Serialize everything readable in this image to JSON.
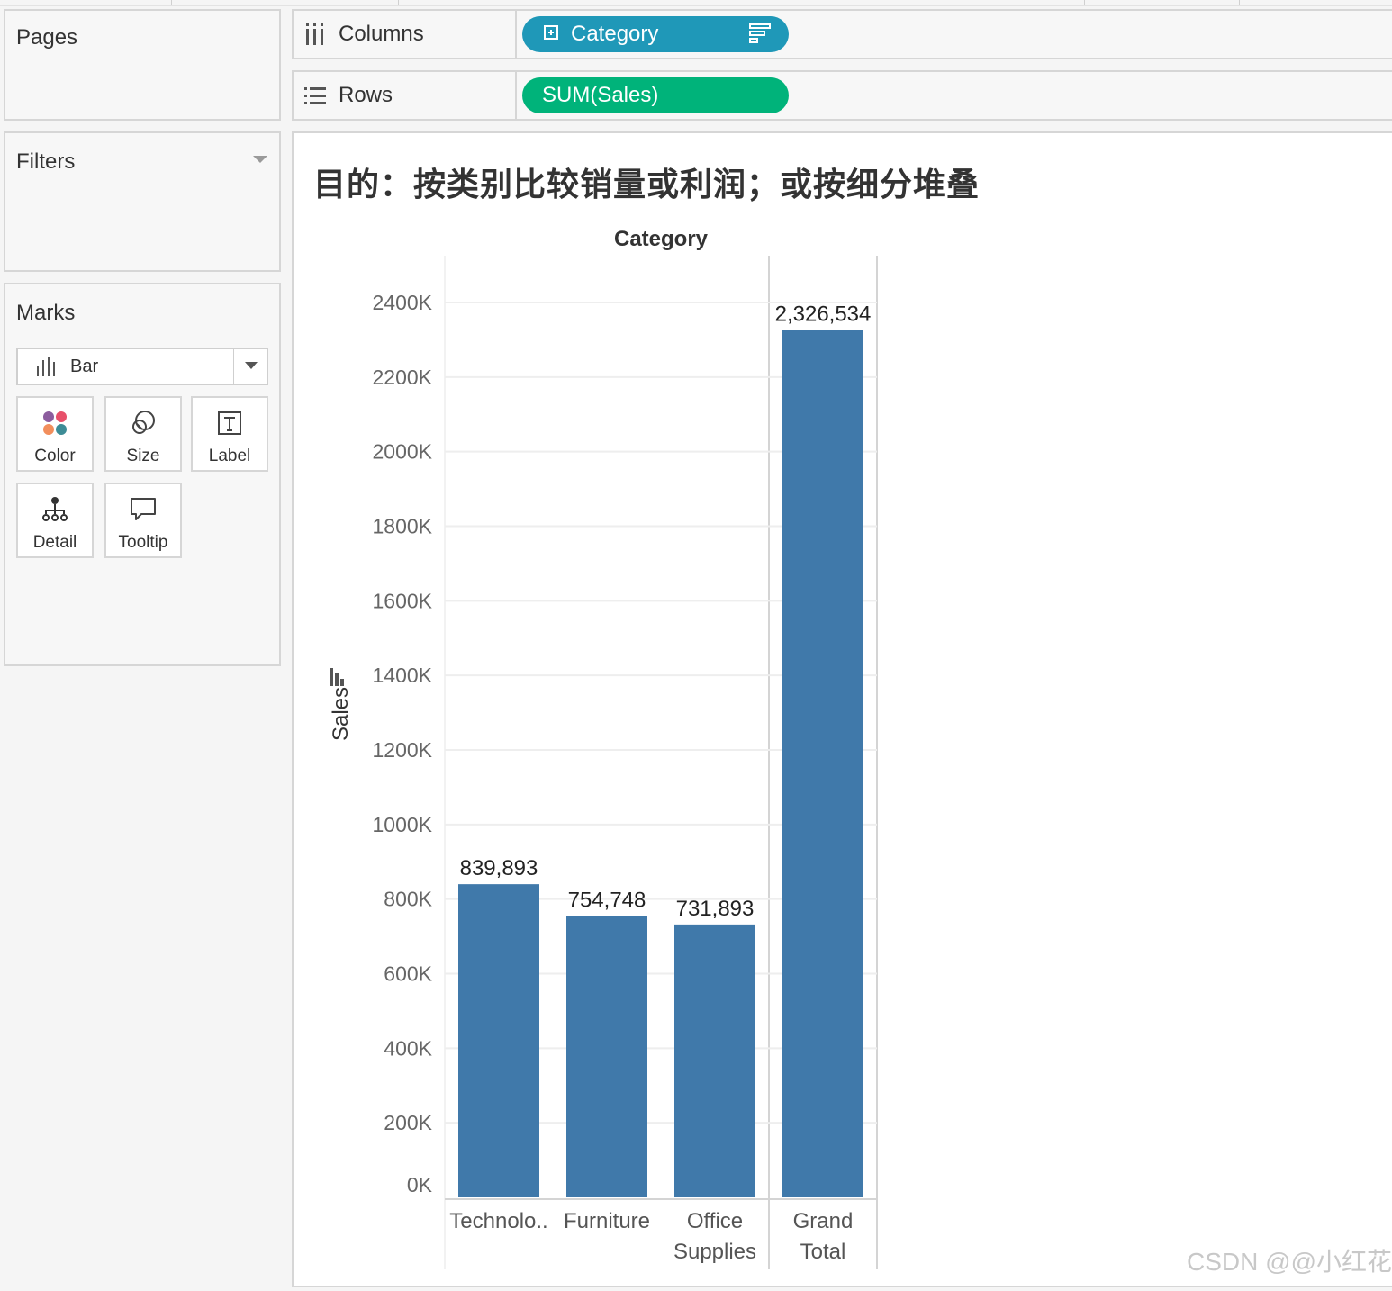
{
  "sidebar": {
    "pages_title": "Pages",
    "filters_title": "Filters",
    "marks_title": "Marks",
    "mark_type": "Bar",
    "mark_buttons": [
      {
        "label": "Color",
        "icon": "color-icon"
      },
      {
        "label": "Size",
        "icon": "size-icon"
      },
      {
        "label": "Label",
        "icon": "label-icon"
      },
      {
        "label": "Detail",
        "icon": "detail-icon"
      },
      {
        "label": "Tooltip",
        "icon": "tooltip-icon"
      }
    ]
  },
  "shelves": {
    "columns_label": "Columns",
    "rows_label": "Rows",
    "columns_pill": "Category",
    "rows_pill": "SUM(Sales)",
    "columns_pill_color": "#1f98b8",
    "rows_pill_color": "#00b37a"
  },
  "viz": {
    "title": "目的：按类别比较销量或利润；或按细分堆叠"
  },
  "chart_data": {
    "type": "bar",
    "title": "目的：按类别比较销量或利润；或按细分堆叠",
    "column_header": "Category",
    "ylabel": "Sales",
    "categories": [
      "Technolo..",
      "Furniture",
      "Office Supplies",
      "Grand Total"
    ],
    "category_lines": [
      [
        "Technolo.."
      ],
      [
        "Furniture"
      ],
      [
        "Office",
        "Supplies"
      ],
      [
        "Grand",
        "Total"
      ]
    ],
    "values": [
      839893,
      754748,
      731893,
      2326534
    ],
    "value_labels": [
      "839,893",
      "754,748",
      "731,893",
      "2,326,534"
    ],
    "ylim": [
      0,
      2400000
    ],
    "yticks": [
      0,
      200000,
      400000,
      600000,
      800000,
      1000000,
      1200000,
      1400000,
      1600000,
      1800000,
      2000000,
      2200000,
      2400000
    ],
    "ytick_labels": [
      "0K",
      "200K",
      "400K",
      "600K",
      "800K",
      "1000K",
      "1200K",
      "1400K",
      "1600K",
      "1800K",
      "2000K",
      "2200K",
      "2400K"
    ],
    "bar_color": "#4079aa",
    "grid": true
  },
  "watermark": "CSDN @@小红花"
}
